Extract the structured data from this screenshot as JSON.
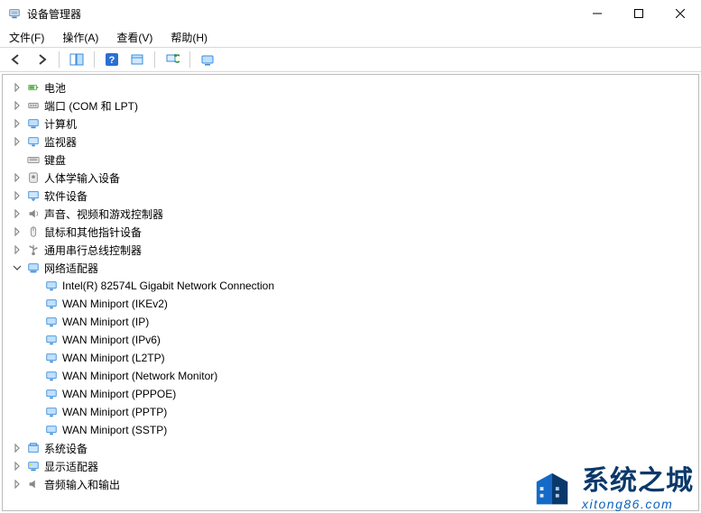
{
  "window": {
    "title": "设备管理器"
  },
  "menu": {
    "file": "文件(F)",
    "action": "操作(A)",
    "view": "查看(V)",
    "help": "帮助(H)"
  },
  "toolbar_icons": {
    "back": "back-icon",
    "forward": "forward-icon",
    "show_hide": "show-hide-icon",
    "help": "help-icon",
    "properties": "properties-icon",
    "scan": "scan-icon",
    "update": "update-icon"
  },
  "tree": [
    {
      "icon": "battery",
      "label": "电池",
      "expanded": false,
      "children": []
    },
    {
      "icon": "port",
      "label": "端口 (COM 和 LPT)",
      "expanded": false,
      "children": []
    },
    {
      "icon": "computer",
      "label": "计算机",
      "expanded": false,
      "children": []
    },
    {
      "icon": "monitor",
      "label": "监视器",
      "expanded": false,
      "children": []
    },
    {
      "icon": "keyboard",
      "label": "键盘",
      "expanded": null,
      "children": []
    },
    {
      "icon": "hid",
      "label": "人体学输入设备",
      "expanded": false,
      "children": []
    },
    {
      "icon": "software",
      "label": "软件设备",
      "expanded": false,
      "children": []
    },
    {
      "icon": "audio",
      "label": "声音、视频和游戏控制器",
      "expanded": false,
      "children": []
    },
    {
      "icon": "mouse",
      "label": "鼠标和其他指针设备",
      "expanded": false,
      "children": []
    },
    {
      "icon": "usb",
      "label": "通用串行总线控制器",
      "expanded": false,
      "children": []
    },
    {
      "icon": "network",
      "label": "网络适配器",
      "expanded": true,
      "children": [
        {
          "icon": "nic",
          "label": "Intel(R) 82574L Gigabit Network Connection"
        },
        {
          "icon": "nic",
          "label": "WAN Miniport (IKEv2)"
        },
        {
          "icon": "nic",
          "label": "WAN Miniport (IP)"
        },
        {
          "icon": "nic",
          "label": "WAN Miniport (IPv6)"
        },
        {
          "icon": "nic",
          "label": "WAN Miniport (L2TP)"
        },
        {
          "icon": "nic",
          "label": "WAN Miniport (Network Monitor)"
        },
        {
          "icon": "nic",
          "label": "WAN Miniport (PPPOE)"
        },
        {
          "icon": "nic",
          "label": "WAN Miniport (PPTP)"
        },
        {
          "icon": "nic",
          "label": "WAN Miniport (SSTP)"
        }
      ]
    },
    {
      "icon": "system",
      "label": "系统设备",
      "expanded": false,
      "children": []
    },
    {
      "icon": "display",
      "label": "显示适配器",
      "expanded": false,
      "children": []
    },
    {
      "icon": "sound-out",
      "label": "音频输入和输出",
      "expanded": false,
      "children": []
    }
  ],
  "watermark": {
    "title_cn": "系统之城",
    "url": "xitong86.com"
  }
}
